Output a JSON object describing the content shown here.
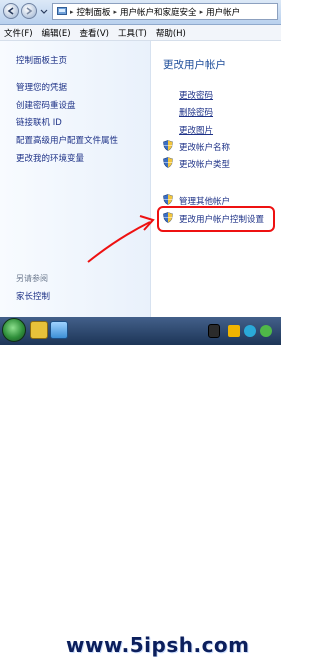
{
  "address_bar": {
    "crumbs": [
      "控制面板",
      "用户帐户和家庭安全",
      "用户帐户"
    ]
  },
  "menubar": {
    "items": [
      "文件(F)",
      "编辑(E)",
      "查看(V)",
      "工具(T)",
      "帮助(H)"
    ]
  },
  "sidebar": {
    "items": [
      "控制面板主页",
      "管理您的凭据",
      "创建密码重设盘",
      "链接联机 ID",
      "配置高级用户配置文件属性",
      "更改我的环境变量"
    ],
    "see_also_label": "另请参阅",
    "see_also_items": [
      "家长控制"
    ]
  },
  "main": {
    "title": "更改用户帐户",
    "links": [
      "更改密码",
      "删除密码",
      "更改图片"
    ],
    "shield_links": [
      "更改帐户名称",
      "更改帐户类型"
    ],
    "other_shield_links": [
      "管理其他帐户",
      "更改用户帐户控制设置"
    ]
  },
  "taskbar": {
    "watermark": "www.5ipsh.com"
  },
  "colors": {
    "highlight": "#e11111",
    "link": "#1e3287",
    "title": "#1e4d9a"
  }
}
